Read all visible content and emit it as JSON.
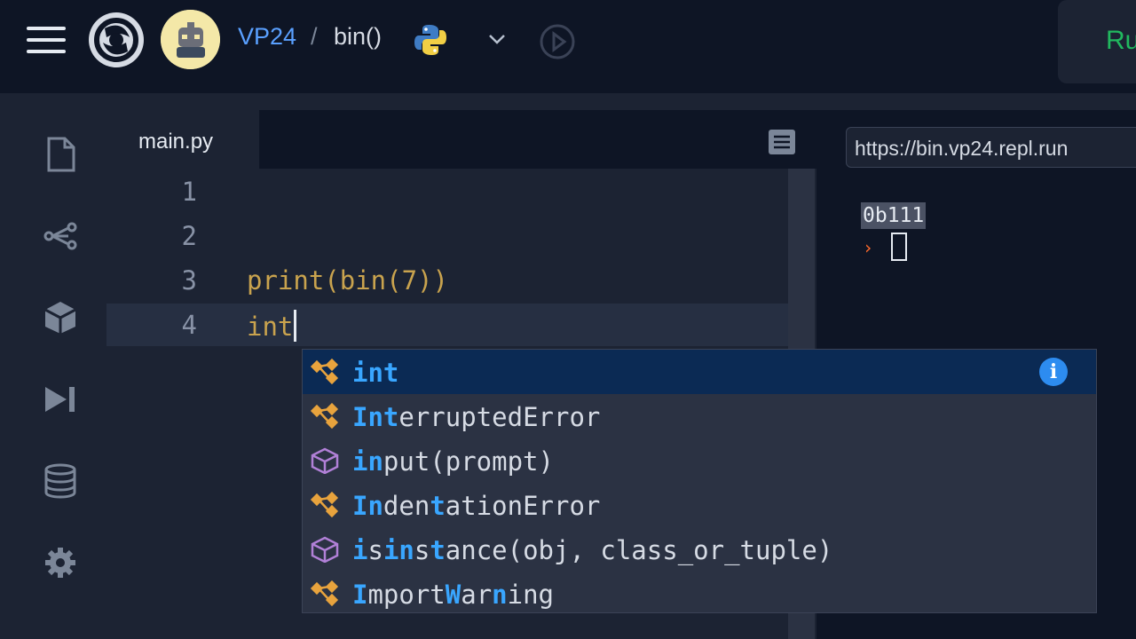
{
  "header": {
    "breadcrumb_user": "VP24",
    "breadcrumb_sep": "/",
    "breadcrumb_repl": "bin()",
    "run_label": "Ru",
    "icons": [
      "menu-icon",
      "replit-logo-icon",
      "user-avatar",
      "python-icon",
      "chevron-down-icon",
      "history-icon"
    ]
  },
  "sidebar": {
    "items": [
      "files-icon",
      "share-icon",
      "packages-icon",
      "debugger-icon",
      "database-icon",
      "settings-icon"
    ]
  },
  "editor": {
    "tab_label": "main.py",
    "lines": [
      {
        "number": "1",
        "code": ""
      },
      {
        "number": "2",
        "code": ""
      },
      {
        "number": "3",
        "code": "print(bin(7))"
      },
      {
        "number": "4",
        "code": "int"
      }
    ]
  },
  "webview": {
    "url": "https://bin.vp24.repl.run",
    "output_line": "0b111",
    "prompt_symbol": "›"
  },
  "autocomplete": {
    "items": [
      {
        "kind": "class",
        "parts": [
          [
            "int",
            true
          ]
        ]
      },
      {
        "kind": "class",
        "parts": [
          [
            "Int",
            true
          ],
          [
            "erruptedError",
            false
          ]
        ]
      },
      {
        "kind": "function",
        "parts": [
          [
            "in",
            true
          ],
          [
            "put(prompt)",
            false
          ]
        ]
      },
      {
        "kind": "class",
        "parts": [
          [
            "In",
            true
          ],
          [
            "den",
            false
          ],
          [
            "t",
            true
          ],
          [
            "ationError",
            false
          ]
        ]
      },
      {
        "kind": "function",
        "parts": [
          [
            "i",
            true
          ],
          [
            "s",
            false
          ],
          [
            "in",
            true
          ],
          [
            "s",
            false
          ],
          [
            "t",
            true
          ],
          [
            "ance(obj, class_or_tuple)",
            false
          ]
        ]
      },
      {
        "kind": "class",
        "parts": [
          [
            "I",
            true
          ],
          [
            "mport",
            false
          ],
          [
            "W",
            true
          ],
          [
            "ar",
            false
          ],
          [
            "n",
            true
          ],
          [
            "ing",
            false
          ]
        ]
      }
    ],
    "selected_index": 0,
    "accent_color": "#39a6ff"
  }
}
